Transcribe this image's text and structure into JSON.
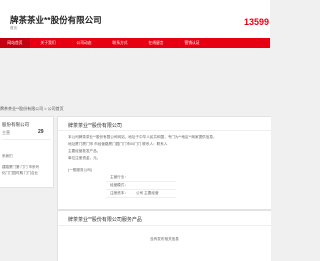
{
  "header": {
    "company": "牌茶茶业**股份有限公司",
    "subtitle": "首页",
    "phone": "13599"
  },
  "nav": {
    "items": [
      "网站首页",
      "关于我们",
      "公司动态",
      "联系方式",
      "在线留言",
      "营销认证"
    ],
    "active_index": 0
  },
  "breadcrumb": "牌茶茶业**股份有限公司 > 公司首页",
  "sidebar": {
    "title": "股份有限公司",
    "stat_label": "主营",
    "stat_value": "29",
    "section": "系我们",
    "lines": [
      "建路厦门第 门门 市系列",
      "化门门园时期 门门合业"
    ]
  },
  "main": {
    "title": "牌茶茶业**股份有限公司",
    "paragraphs": [
      "本公司牌茶茶业**股份有限公司网站，地址于中华人民共和国，专门为**地区**商家提供信息。",
      "地址厦门厦门市 市经营路厦门园门门市00门门 联系人：联系人",
      "主要经营批发产品。",
      "单位注册资金，元。"
    ],
    "note": "(一般服务公司)",
    "kv": [
      {
        "k": "主营行业：",
        "v": ""
      },
      {
        "k": "经营模式：",
        "v": ""
      },
      {
        "k": "注册资本：",
        "v": "公司 主要经营"
      }
    ]
  },
  "products": {
    "title": "牌茶茶业**股份有限公司服务产品",
    "empty": "没有发布相关信息"
  }
}
